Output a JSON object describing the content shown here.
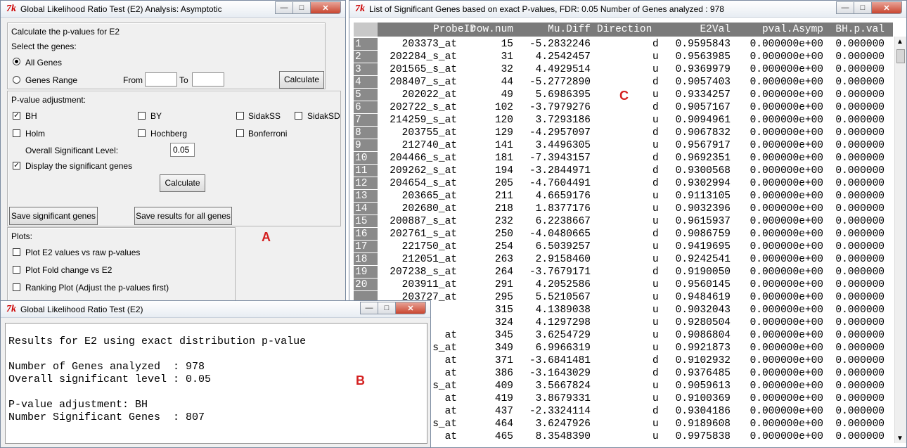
{
  "window_a": {
    "title": "Global Likelihood Ratio Test (E2) Analysis: Asymptotic",
    "calc_section": "Calculate the p-values for E2",
    "select_genes": "Select the genes:",
    "all_genes": "All Genes",
    "genes_range": "Genes Range",
    "from": "From",
    "to": "To",
    "from_value": "",
    "to_value": "",
    "calculate": "Calculate",
    "pvalue_adjustment": "P-value adjustment:",
    "methods": {
      "bh": "BH",
      "by": "BY",
      "sidakss": "SidakSS",
      "sidaksd": "SidakSD",
      "holm": "Holm",
      "hochberg": "Hochberg",
      "bonferroni": "Bonferroni"
    },
    "overall_level_label": "Overall Significant Level:",
    "overall_level_value": "0.05",
    "display_sig": "Display the significant genes",
    "calculate2": "Calculate",
    "save_sig": "Save significant genes",
    "save_all": "Save results for all genes",
    "plots": "Plots:",
    "plot1": "Plot E2 values vs raw p-values",
    "plot2": "Plot Fold change vs E2",
    "plot3": "Ranking Plot (Adjust the p-values first)",
    "marker": "A"
  },
  "window_b": {
    "title": "Global Likelihood Ratio Test (E2)",
    "lines": [
      "Results for E2 using exact distribution p-value",
      "",
      "Number of Genes analyzed  : 978",
      "Overall significant level : 0.05",
      "",
      "P-value adjustment: BH",
      "Number Significant Genes  : 807"
    ],
    "marker": "B"
  },
  "window_c": {
    "title": "List of Significant Genes based on exact P-values, FDR: 0.05   Number of Genes analyzed : 978",
    "marker": "C",
    "columns": [
      "ProbeID",
      "row.num",
      "Mu.Diff",
      "Direction",
      "E2Val",
      "pval.Asymp",
      "BH.p.val"
    ],
    "rows": [
      [
        "1",
        "203373_at",
        "15",
        "-5.2832246",
        "d",
        "0.9595843",
        "0.000000e+00",
        "0.000000"
      ],
      [
        "2",
        "202284_s_at",
        "31",
        "4.2542457",
        "u",
        "0.9563985",
        "0.000000e+00",
        "0.000000"
      ],
      [
        "3",
        "201565_s_at",
        "32",
        "4.4929514",
        "u",
        "0.9369979",
        "0.000000e+00",
        "0.000000"
      ],
      [
        "4",
        "208407_s_at",
        "44",
        "-5.2772890",
        "d",
        "0.9057403",
        "0.000000e+00",
        "0.000000"
      ],
      [
        "5",
        "202022_at",
        "49",
        "5.6986395",
        "u",
        "0.9334257",
        "0.000000e+00",
        "0.000000"
      ],
      [
        "6",
        "202722_s_at",
        "102",
        "-3.7979276",
        "d",
        "0.9057167",
        "0.000000e+00",
        "0.000000"
      ],
      [
        "7",
        "214259_s_at",
        "120",
        "3.7293186",
        "u",
        "0.9094961",
        "0.000000e+00",
        "0.000000"
      ],
      [
        "8",
        "203755_at",
        "129",
        "-4.2957097",
        "d",
        "0.9067832",
        "0.000000e+00",
        "0.000000"
      ],
      [
        "9",
        "212740_at",
        "141",
        "3.4496305",
        "u",
        "0.9567917",
        "0.000000e+00",
        "0.000000"
      ],
      [
        "10",
        "204466_s_at",
        "181",
        "-7.3943157",
        "d",
        "0.9692351",
        "0.000000e+00",
        "0.000000"
      ],
      [
        "11",
        "209262_s_at",
        "194",
        "-3.2844971",
        "d",
        "0.9300568",
        "0.000000e+00",
        "0.000000"
      ],
      [
        "12",
        "204654_s_at",
        "205",
        "-4.7604491",
        "d",
        "0.9302994",
        "0.000000e+00",
        "0.000000"
      ],
      [
        "13",
        "203665_at",
        "211",
        "4.6659176",
        "u",
        "0.9113105",
        "0.000000e+00",
        "0.000000"
      ],
      [
        "14",
        "202680_at",
        "218",
        "1.8377176",
        "u",
        "0.9032396",
        "0.000000e+00",
        "0.000000"
      ],
      [
        "15",
        "200887_s_at",
        "232",
        "6.2238667",
        "u",
        "0.9615937",
        "0.000000e+00",
        "0.000000"
      ],
      [
        "16",
        "202761_s_at",
        "250",
        "-4.0480665",
        "d",
        "0.9086759",
        "0.000000e+00",
        "0.000000"
      ],
      [
        "17",
        "221750_at",
        "254",
        "6.5039257",
        "u",
        "0.9419695",
        "0.000000e+00",
        "0.000000"
      ],
      [
        "18",
        "212051_at",
        "263",
        "2.9158460",
        "u",
        "0.9242541",
        "0.000000e+00",
        "0.000000"
      ],
      [
        "19",
        "207238_s_at",
        "264",
        "-3.7679171",
        "d",
        "0.9190050",
        "0.000000e+00",
        "0.000000"
      ],
      [
        "20",
        "203911_at",
        "291",
        "4.2052586",
        "u",
        "0.9560145",
        "0.000000e+00",
        "0.000000"
      ],
      [
        "",
        "203727_at",
        "295",
        "5.5210567",
        "u",
        "0.9484619",
        "0.000000e+00",
        "0.000000"
      ],
      [
        "",
        "",
        "315",
        "4.1389038",
        "u",
        "0.9032043",
        "0.000000e+00",
        "0.000000"
      ],
      [
        "",
        "",
        "324",
        "4.1297298",
        "u",
        "0.9280504",
        "0.000000e+00",
        "0.000000"
      ],
      [
        "",
        "at",
        "345",
        "3.6254729",
        "u",
        "0.9086804",
        "0.000000e+00",
        "0.000000"
      ],
      [
        "",
        "s_at",
        "349",
        "6.9966319",
        "u",
        "0.9921873",
        "0.000000e+00",
        "0.000000"
      ],
      [
        "",
        "at",
        "371",
        "-3.6841481",
        "d",
        "0.9102932",
        "0.000000e+00",
        "0.000000"
      ],
      [
        "",
        "at",
        "386",
        "-3.1643029",
        "d",
        "0.9376485",
        "0.000000e+00",
        "0.000000"
      ],
      [
        "",
        "s_at",
        "409",
        "3.5667824",
        "u",
        "0.9059613",
        "0.000000e+00",
        "0.000000"
      ],
      [
        "",
        "at",
        "419",
        "3.8679331",
        "u",
        "0.9100369",
        "0.000000e+00",
        "0.000000"
      ],
      [
        "",
        "at",
        "437",
        "-2.3324114",
        "d",
        "0.9304186",
        "0.000000e+00",
        "0.000000"
      ],
      [
        "",
        "s_at",
        "464",
        "3.6247926",
        "u",
        "0.9189608",
        "0.000000e+00",
        "0.000000"
      ],
      [
        "",
        "at",
        "465",
        "8.3548390",
        "u",
        "0.9975838",
        "0.000000e+00",
        "0.000000"
      ]
    ]
  }
}
